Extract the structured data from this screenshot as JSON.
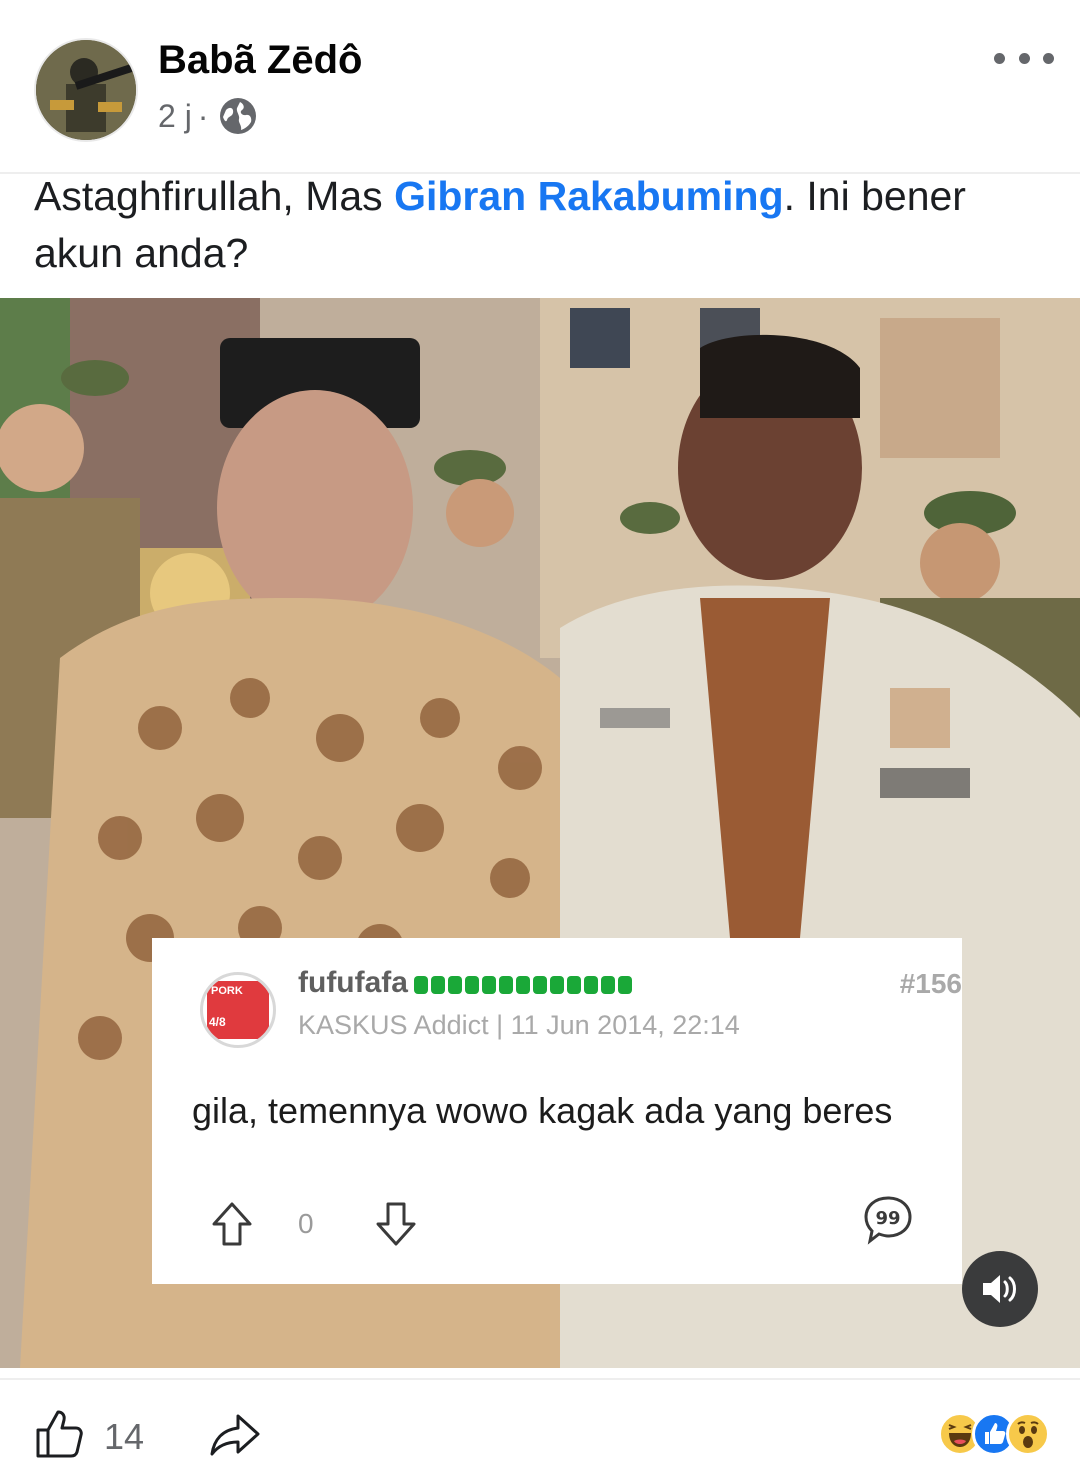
{
  "post": {
    "author_name": "Babã Zēdô",
    "time": "2 j",
    "separator": "·",
    "privacy_icon": "globe-icon",
    "caption_before": "Astaghfirullah, Mas ",
    "caption_mention": "Gibran Rakabuming",
    "caption_after": ". Ini bener akun anda?"
  },
  "embedded_comment": {
    "username": "fufufafa",
    "post_number": "#156",
    "rank_and_date": "KASKUS Addict | 11 Jun 2014, 22:14",
    "text": "gila, temennya wowo kagak ada yang beres",
    "vote_count": "0",
    "badge_top": "PORK",
    "badge_bottom": "4/8"
  },
  "footer": {
    "like_count": "14",
    "reactions": [
      "haha",
      "like",
      "wow"
    ]
  },
  "colors": {
    "mention": "#1877f2",
    "meta_text": "#65676b",
    "reputation_green": "#1aa838",
    "badge_red": "#e03a3e"
  }
}
